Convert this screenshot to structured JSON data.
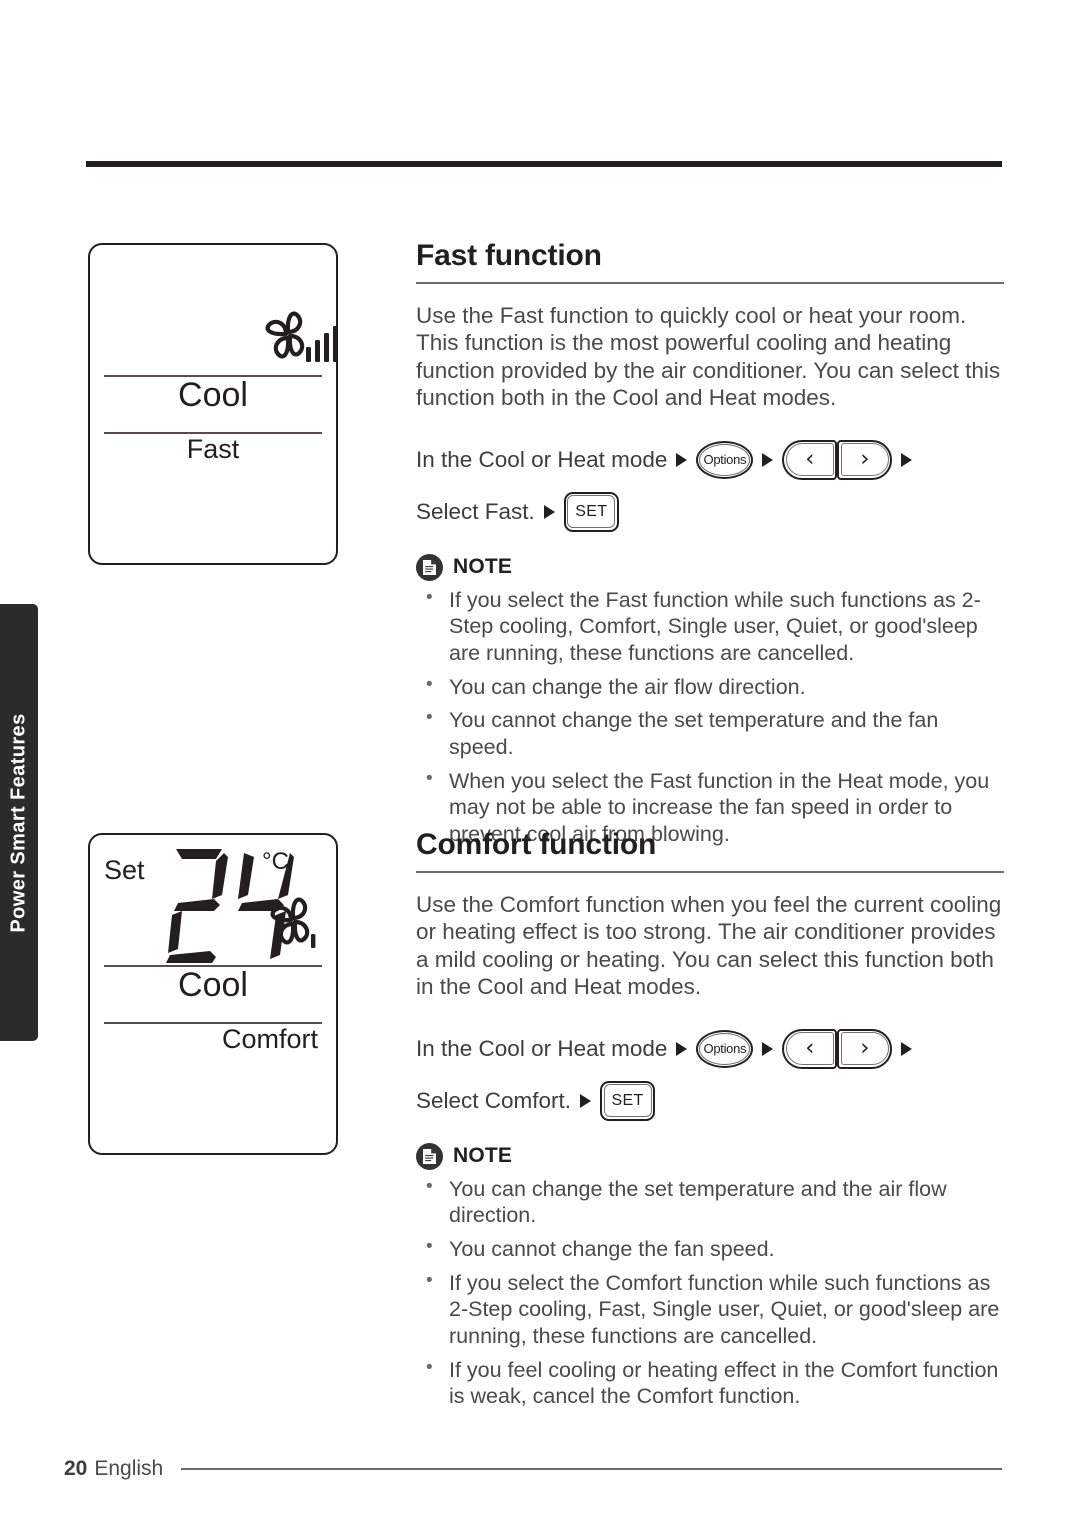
{
  "sidebar": {
    "tab_label": "Power Smart Features"
  },
  "footer": {
    "page_number": "20",
    "language": "English"
  },
  "panels": [
    {
      "name": "fast-display",
      "mode_label": "Cool",
      "function_label": "Fast",
      "fan_icon": "fan-pinwheel-icon",
      "fan_bars": 4,
      "set_label": "",
      "temperature": "",
      "unit": ""
    },
    {
      "name": "comfort-display",
      "mode_label": "Cool",
      "function_label": "Comfort",
      "fan_icon": "fan-pinwheel-icon",
      "fan_bars": 1,
      "set_label": "Set",
      "temperature": "24",
      "unit": "°C"
    }
  ],
  "sections": [
    {
      "id": "fast",
      "title": "Fast function",
      "body": "Use the Fast function to quickly cool or heat your room. This function is the most powerful cooling and heating function provided by the air conditioner. You can select this function both in the Cool and Heat modes.",
      "steps": {
        "row1_lead": "In the Cool or Heat mode",
        "row2_lead": "Select Fast.",
        "options_label": "Options",
        "left_glyph": "‹",
        "right_glyph": "›",
        "set_label": "SET"
      },
      "note": {
        "icon": "note-document-icon",
        "title": "NOTE",
        "items": [
          "If you select the Fast function while such functions as 2-Step cooling, Comfort, Single user, Quiet, or good'sleep are running, these functions are cancelled.",
          "You can change the air flow direction.",
          "You cannot change the set temperature and the fan speed.",
          "When you select the Fast function in the Heat mode, you may not be able to increase the fan speed in order to prevent cool air from blowing."
        ]
      }
    },
    {
      "id": "comfort",
      "title": "Comfort function",
      "body": "Use the Comfort function when you feel the current cooling or heating effect is too strong. The air conditioner provides a mild cooling or heating. You can select this function both in the Cool and Heat modes.",
      "steps": {
        "row1_lead": "In the Cool or Heat mode",
        "row2_lead": "Select Comfort.",
        "options_label": "Options",
        "left_glyph": "‹",
        "right_glyph": "›",
        "set_label": "SET"
      },
      "note": {
        "icon": "note-document-icon",
        "title": "NOTE",
        "items": [
          "You can change the set temperature and the air flow direction.",
          "You cannot change the fan speed.",
          "If you select the Comfort function while such functions as 2-Step cooling, Fast, Single user, Quiet, or good'sleep are running, these functions are cancelled.",
          "If you feel cooling or heating effect in the Comfort function is weak, cancel the Comfort function."
        ]
      }
    }
  ],
  "colors": {
    "ink": "#231f20",
    "body_text": "#4a4a4a",
    "rule": "#6d6d6d",
    "tab_bg": "#2b2b2b"
  }
}
